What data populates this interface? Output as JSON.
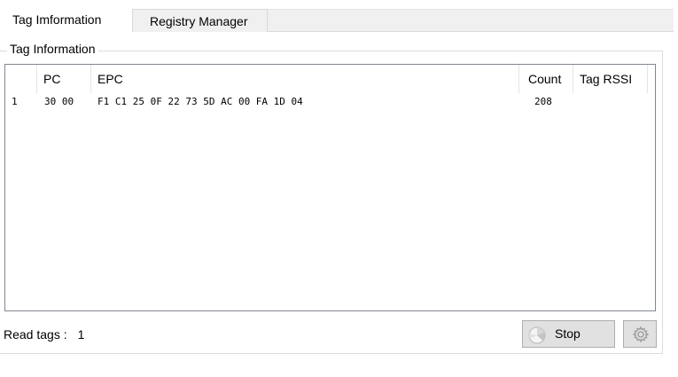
{
  "tabs": [
    {
      "label": "Tag Imformation",
      "active": true
    },
    {
      "label": "Registry Manager",
      "active": false
    }
  ],
  "group": {
    "title": "Tag Information"
  },
  "table": {
    "columns": [
      "",
      "PC",
      "EPC",
      "Count",
      "Tag RSSI"
    ],
    "rows": [
      {
        "index": "1",
        "pc": "30 00",
        "epc": "F1 C1 25 0F 22 73 5D AC 00 FA 1D 04",
        "count": "208",
        "rssi": ""
      }
    ]
  },
  "footer": {
    "read_tags_label": "Read tags :",
    "read_tags_value": "1",
    "stop_label": "Stop",
    "stop_icon": "pie-chart-icon",
    "settings_icon": "gear-icon"
  },
  "colors": {
    "tab_inactive_bg": "#f0f0f0",
    "button_bg": "#e1e1e1",
    "list_border": "#828790"
  }
}
